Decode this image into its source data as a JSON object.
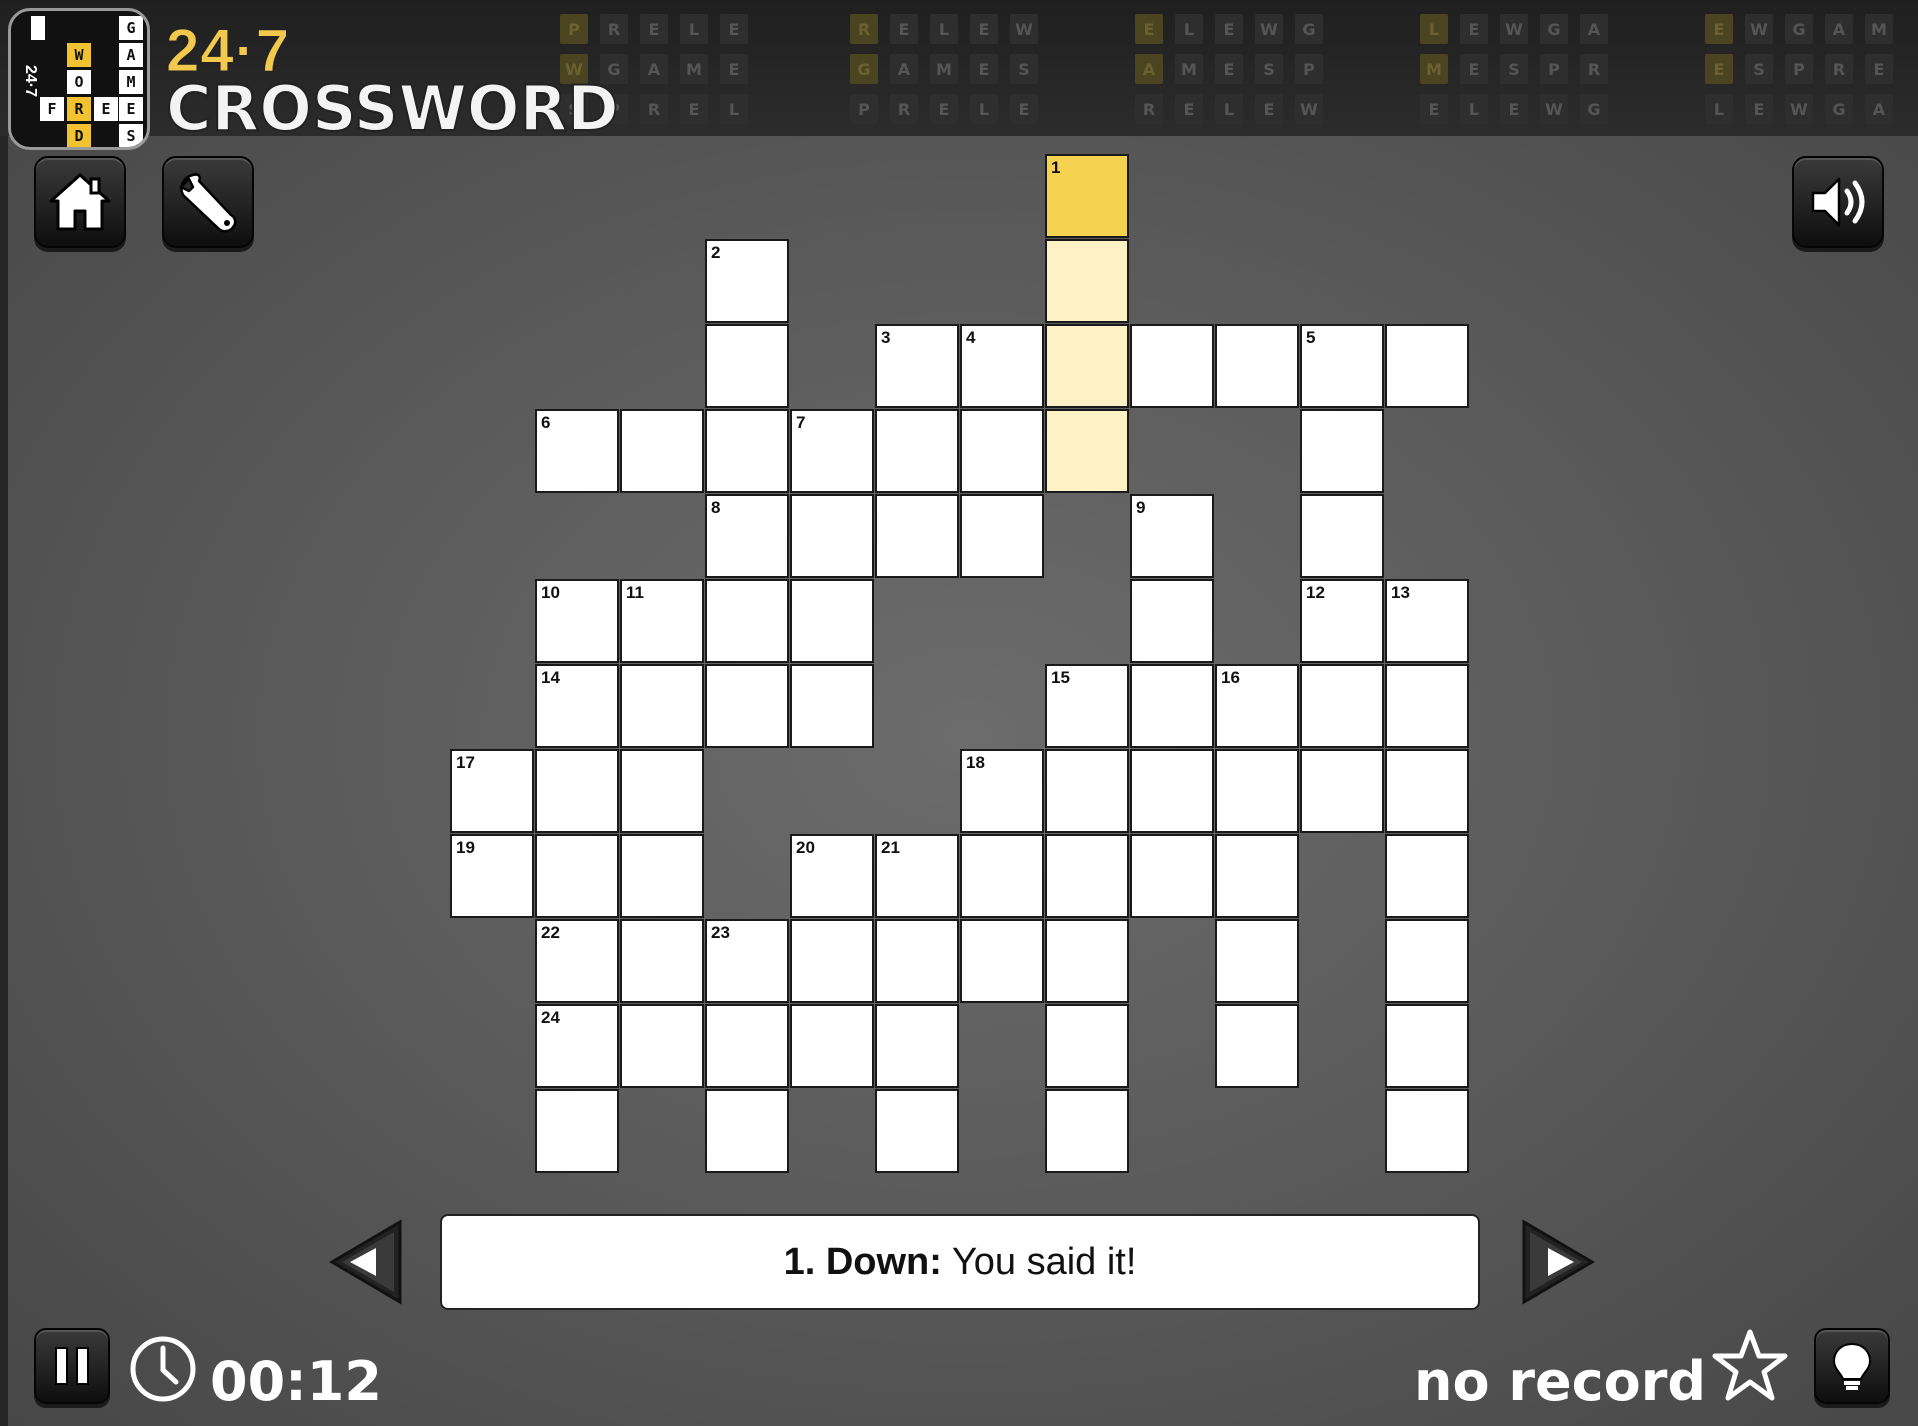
{
  "brand": {
    "number": "24·7",
    "word": "CROSSWORD"
  },
  "logo": {
    "side_text": "24·7",
    "tiles_left": [
      "W",
      "O",
      "R",
      "D"
    ],
    "tiles_right": [
      "G",
      "A",
      "M",
      "E",
      "S"
    ],
    "tiles_row": [
      "F",
      "R",
      "E",
      "E"
    ]
  },
  "header_bg_letters": [
    "P",
    "R",
    "E",
    "L",
    "E",
    "W",
    "G",
    "A",
    "M",
    "E",
    "S"
  ],
  "toolbar": {
    "home_icon": "home-icon",
    "settings_icon": "wrench-icon",
    "sound_icon": "speaker-icon"
  },
  "grid": {
    "cells": [
      [
        7,
        1,
        "1"
      ],
      [
        3,
        2,
        "2"
      ],
      [
        7,
        2,
        ""
      ],
      [
        3,
        3,
        ""
      ],
      [
        5,
        3,
        "3"
      ],
      [
        6,
        3,
        "4"
      ],
      [
        7,
        3,
        ""
      ],
      [
        8,
        3,
        ""
      ],
      [
        9,
        3,
        ""
      ],
      [
        10,
        3,
        "5"
      ],
      [
        11,
        3,
        ""
      ],
      [
        1,
        4,
        "6"
      ],
      [
        2,
        4,
        ""
      ],
      [
        3,
        4,
        ""
      ],
      [
        4,
        4,
        "7"
      ],
      [
        5,
        4,
        ""
      ],
      [
        6,
        4,
        ""
      ],
      [
        7,
        4,
        ""
      ],
      [
        10,
        4,
        ""
      ],
      [
        3,
        5,
        "8"
      ],
      [
        4,
        5,
        ""
      ],
      [
        5,
        5,
        ""
      ],
      [
        6,
        5,
        ""
      ],
      [
        8,
        5,
        "9"
      ],
      [
        10,
        5,
        ""
      ],
      [
        1,
        6,
        "10"
      ],
      [
        2,
        6,
        "11"
      ],
      [
        3,
        6,
        ""
      ],
      [
        4,
        6,
        ""
      ],
      [
        8,
        6,
        ""
      ],
      [
        10,
        6,
        "12"
      ],
      [
        11,
        6,
        "13"
      ],
      [
        1,
        7,
        "14"
      ],
      [
        2,
        7,
        ""
      ],
      [
        3,
        7,
        ""
      ],
      [
        4,
        7,
        ""
      ],
      [
        7,
        7,
        "15"
      ],
      [
        8,
        7,
        ""
      ],
      [
        9,
        7,
        "16"
      ],
      [
        10,
        7,
        ""
      ],
      [
        11,
        7,
        ""
      ],
      [
        0,
        8,
        "17"
      ],
      [
        1,
        8,
        ""
      ],
      [
        2,
        8,
        ""
      ],
      [
        6,
        8,
        "18"
      ],
      [
        7,
        8,
        ""
      ],
      [
        8,
        8,
        ""
      ],
      [
        9,
        8,
        ""
      ],
      [
        10,
        8,
        ""
      ],
      [
        11,
        8,
        ""
      ],
      [
        0,
        9,
        "19"
      ],
      [
        1,
        9,
        ""
      ],
      [
        2,
        9,
        ""
      ],
      [
        4,
        9,
        "20"
      ],
      [
        5,
        9,
        "21"
      ],
      [
        6,
        9,
        ""
      ],
      [
        7,
        9,
        ""
      ],
      [
        8,
        9,
        ""
      ],
      [
        9,
        9,
        ""
      ],
      [
        11,
        9,
        ""
      ],
      [
        1,
        10,
        "22"
      ],
      [
        2,
        10,
        ""
      ],
      [
        3,
        10,
        "23"
      ],
      [
        4,
        10,
        ""
      ],
      [
        5,
        10,
        ""
      ],
      [
        6,
        10,
        ""
      ],
      [
        7,
        10,
        ""
      ],
      [
        9,
        10,
        ""
      ],
      [
        11,
        10,
        ""
      ],
      [
        1,
        11,
        "24"
      ],
      [
        2,
        11,
        ""
      ],
      [
        3,
        11,
        ""
      ],
      [
        4,
        11,
        ""
      ],
      [
        5,
        11,
        ""
      ],
      [
        7,
        11,
        ""
      ],
      [
        9,
        11,
        ""
      ],
      [
        11,
        11,
        ""
      ],
      [
        1,
        12,
        ""
      ],
      [
        3,
        12,
        ""
      ],
      [
        5,
        12,
        ""
      ],
      [
        7,
        12,
        ""
      ],
      [
        11,
        12,
        ""
      ]
    ],
    "selected": [
      7,
      1
    ],
    "highlighted": [
      [
        7,
        2
      ],
      [
        7,
        3
      ],
      [
        7,
        4
      ]
    ]
  },
  "clue": {
    "label": "1. Down:",
    "text": "You said it!"
  },
  "footer": {
    "timer": "00:12",
    "record": "no record"
  },
  "colors": {
    "selected": "#f5d350",
    "highlight": "#fcf2c6",
    "brand_yellow": "#f2c94c"
  }
}
